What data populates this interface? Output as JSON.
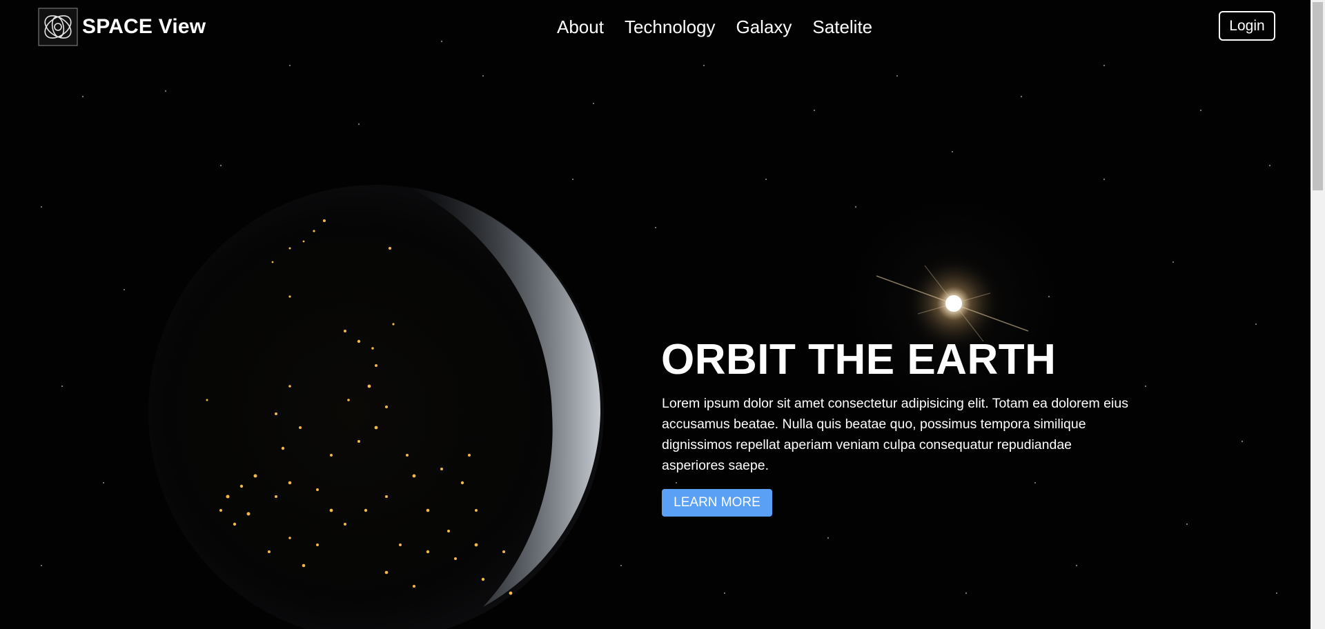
{
  "brand": {
    "name": "SPACE View",
    "logo_icon": "swirl-logo-icon"
  },
  "nav": {
    "items": [
      {
        "label": "About"
      },
      {
        "label": "Technology"
      },
      {
        "label": "Galaxy"
      },
      {
        "label": "Satelite"
      }
    ],
    "login_label": "Login"
  },
  "hero": {
    "title": "ORBIT THE EARTH",
    "body": "Lorem ipsum dolor sit amet consectetur adipisicing elit. Totam ea dolorem eius accusamus beatae. Nulla quis beatae quo, possimus tempora similique dignissimos repellat aperiam veniam culpa consequatur repudiandae asperiores saepe.",
    "button_label": "LEARN MORE"
  },
  "colors": {
    "background": "#020203",
    "accent": "#5aa0f5",
    "text": "#ffffff",
    "city_lights": "#f2b84b"
  },
  "icons": {
    "earth": "earth-at-night-icon",
    "sun": "sun-flare-icon"
  }
}
